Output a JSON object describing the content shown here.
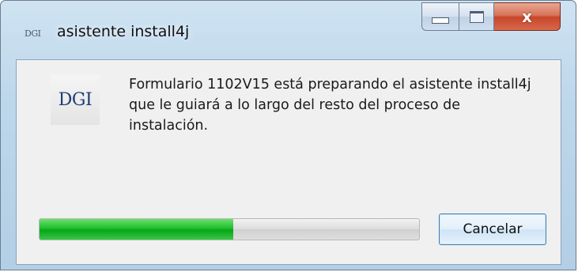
{
  "window": {
    "title": "asistente install4j",
    "app_icon_text": "DGI"
  },
  "caption_buttons": {
    "minimize": "minimize",
    "maximize": "maximize",
    "close": "x"
  },
  "content": {
    "logo_text": "DGI",
    "message": "Formulario 1102V15 está preparando el asistente install4j que le guiará a lo largo del resto del proceso de instalación."
  },
  "progress": {
    "fraction": 0.51
  },
  "buttons": {
    "cancel_label": "Cancelar"
  },
  "colors": {
    "progress_fill": "#0aa51a",
    "close_button": "#c7462b"
  },
  "icons": {
    "app": "dgi-logo-icon",
    "minimize": "minimize-icon",
    "maximize": "maximize-icon",
    "close": "close-icon"
  }
}
